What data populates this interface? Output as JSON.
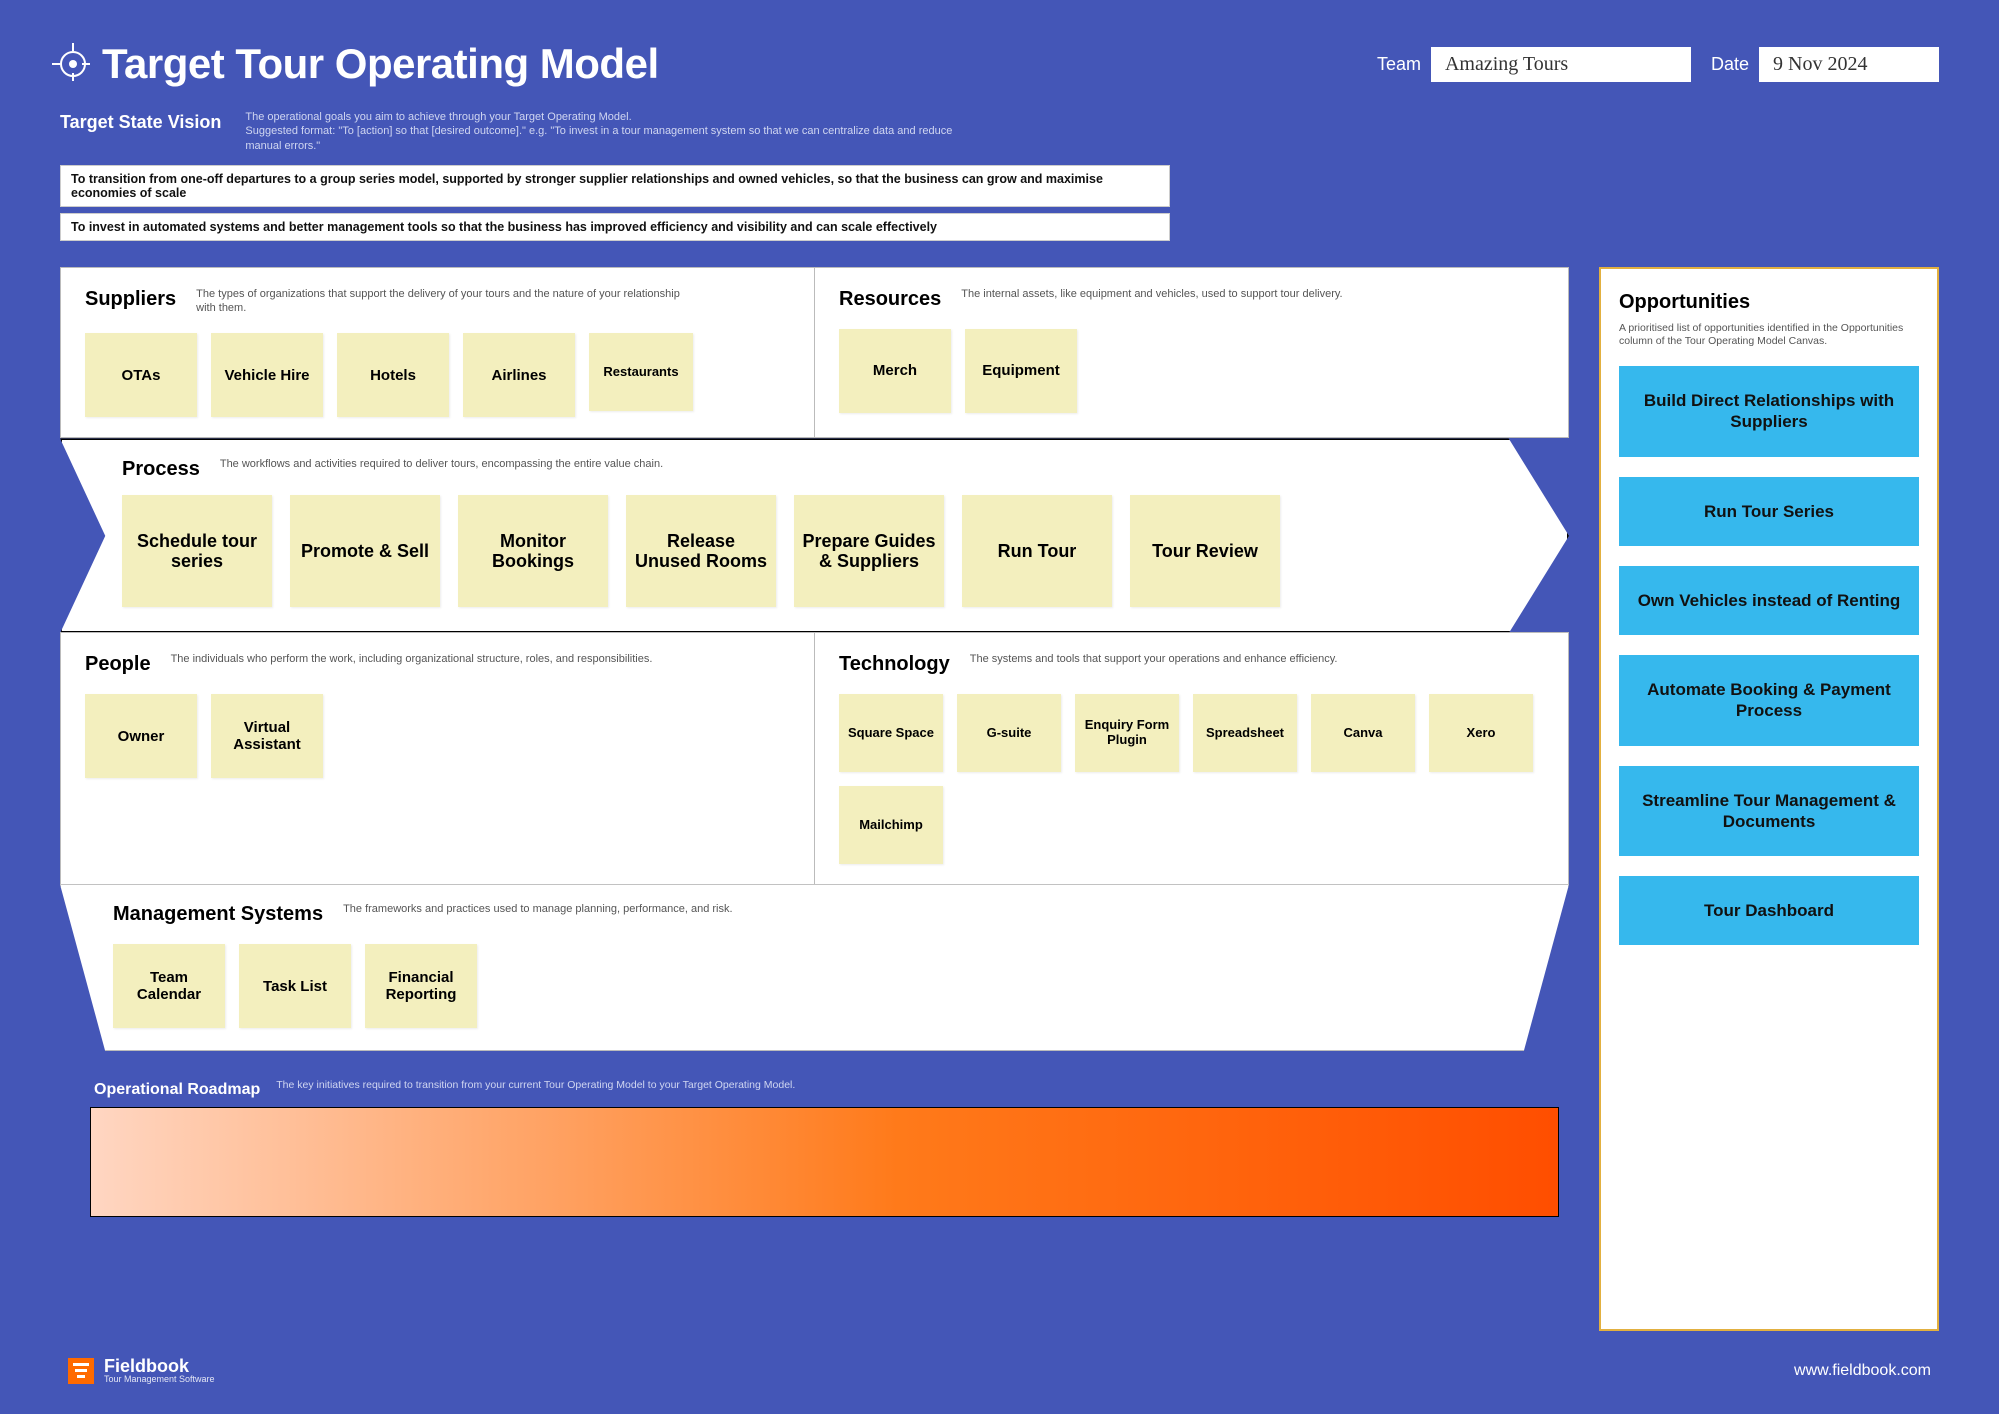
{
  "header": {
    "title": "Target Tour Operating Model",
    "team_label": "Team",
    "team_value": "Amazing Tours",
    "date_label": "Date",
    "date_value": "9 Nov 2024"
  },
  "vision": {
    "label": "Target State Vision",
    "subtitle": "The operational goals you aim to achieve through your Target Operating Model.\nSuggested format: \"To [action] so that [desired outcome].\" e.g. \"To invest in a tour management system so that we can centralize data and reduce manual errors.\"",
    "statements": [
      "To transition from one-off departures to a group series model, supported by stronger supplier relationships and owned vehicles, so that the business can grow and maximise economies of scale",
      "To invest in automated systems and better management tools so that the business has improved efficiency and visibility and can scale effectively"
    ]
  },
  "sections": {
    "suppliers": {
      "title": "Suppliers",
      "desc": "The types of organizations that support the delivery of your tours and the nature of your relationship with them.",
      "items": [
        "OTAs",
        "Vehicle Hire",
        "Hotels",
        "Airlines",
        "Restaurants"
      ]
    },
    "resources": {
      "title": "Resources",
      "desc": "The internal assets, like equipment and vehicles, used to support tour delivery.",
      "items": [
        "Merch",
        "Equipment"
      ]
    },
    "process": {
      "title": "Process",
      "desc": "The workflows and activities required to deliver tours, encompassing the entire value chain.",
      "items": [
        "Schedule tour series",
        "Promote & Sell",
        "Monitor Bookings",
        "Release Unused Rooms",
        "Prepare Guides & Suppliers",
        "Run Tour",
        "Tour Review"
      ]
    },
    "people": {
      "title": "People",
      "desc": "The individuals who perform the work, including organizational structure, roles, and responsibilities.",
      "items": [
        "Owner",
        "Virtual Assistant"
      ]
    },
    "technology": {
      "title": "Technology",
      "desc": "The systems and tools that support your operations and enhance efficiency.",
      "items": [
        "Square Space",
        "G-suite",
        "Enquiry Form Plugin",
        "Spreadsheet",
        "Canva",
        "Xero",
        "Mailchimp"
      ]
    },
    "management": {
      "title": "Management Systems",
      "desc": "The frameworks and practices used to manage planning, performance, and risk.",
      "items": [
        "Team Calendar",
        "Task List",
        "Financial Reporting"
      ]
    }
  },
  "opportunities": {
    "title": "Opportunities",
    "desc": "A prioritised list of opportunities identified in the Opportunities column of the Tour Operating Model Canvas.",
    "items": [
      "Build Direct Relationships with Suppliers",
      "Run Tour Series",
      "Own Vehicles instead of Renting",
      "Automate Booking & Payment Process",
      "Streamline Tour Management & Documents",
      "Tour Dashboard"
    ]
  },
  "roadmap": {
    "title": "Operational Roadmap",
    "desc": "The key initiatives required to transition from your current Tour Operating Model to your Target Operating Model."
  },
  "footer": {
    "brand_name": "Fieldbook",
    "brand_tag": "Tour Management Software",
    "url": "www.fieldbook.com"
  }
}
